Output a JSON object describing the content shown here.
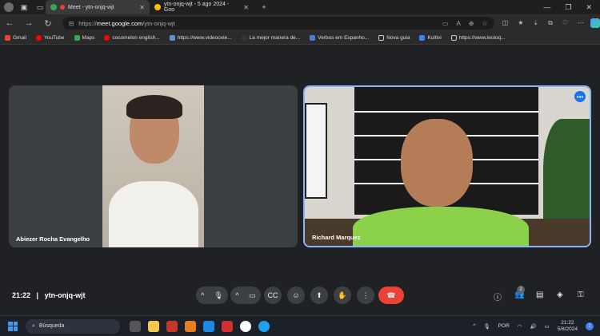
{
  "browser": {
    "tabs": [
      {
        "label": "Meet - ytn-onjq-wjt",
        "active": true
      },
      {
        "label": "ytn-onjq-wjt - 5 ago 2024 - Goo",
        "active": false
      }
    ],
    "url_host": "meet.google.com",
    "url_prefix": "https://",
    "url_path": "/ytn-onjq-wjt",
    "bookmarks": [
      "Gmail",
      "YouTube",
      "Maps",
      "cocomelon english...",
      "https://www.videocele...",
      "La mejor manera de...",
      "Verbos em Espanho...",
      "Nova guia",
      "Kultivi",
      "https://www.leoloq..."
    ]
  },
  "meet": {
    "participants": [
      {
        "name": "Abiezer Rocha Evangelho"
      },
      {
        "name": "Richard Marquez"
      }
    ],
    "time": "21:22",
    "separator": "|",
    "meeting_code": "ytn-onjq-wjt",
    "people_count": "2",
    "accent": "#1a73e8",
    "end_color": "#ea4335"
  },
  "taskbar": {
    "search_placeholder": "Búsqueda",
    "language": "POR",
    "clock_time": "21:22",
    "clock_date": "5/8/2024",
    "notification_count": "2"
  }
}
